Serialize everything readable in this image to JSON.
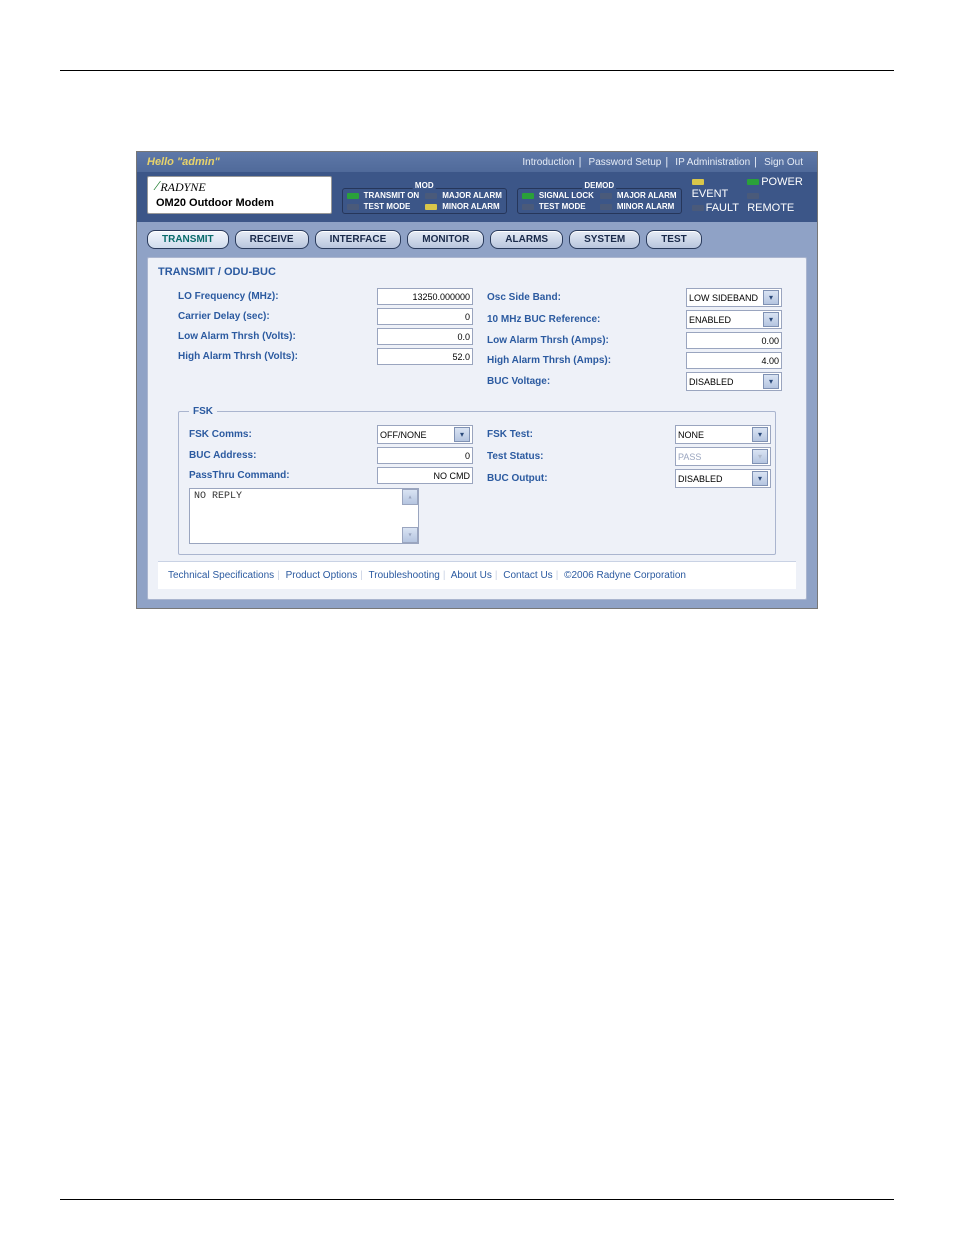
{
  "topbar": {
    "hello": "Hello \"admin\"",
    "links": [
      "Introduction",
      "Password Setup",
      "IP Administration",
      "Sign Out"
    ]
  },
  "logo": {
    "brand": "RADYNE",
    "subtitle": "OM20 Outdoor Modem"
  },
  "status": {
    "mod": {
      "title": "MOD",
      "items": [
        {
          "label": "TRANSMIT ON",
          "led": "green"
        },
        {
          "label": "TEST MODE",
          "led": "dark"
        },
        {
          "label": "MAJOR ALARM",
          "led": "dark"
        },
        {
          "label": "MINOR ALARM",
          "led": "yellow"
        }
      ]
    },
    "demod": {
      "title": "DEMOD",
      "items": [
        {
          "label": "SIGNAL LOCK",
          "led": "green"
        },
        {
          "label": "TEST MODE",
          "led": "dark"
        },
        {
          "label": "MAJOR ALARM",
          "led": "dark"
        },
        {
          "label": "MINOR ALARM",
          "led": "dark"
        }
      ]
    },
    "sys": {
      "items": [
        {
          "label": "EVENT",
          "led": "yellow"
        },
        {
          "label": "FAULT",
          "led": "dark"
        },
        {
          "label": "POWER",
          "led": "green"
        },
        {
          "label": "REMOTE",
          "led": "dark"
        }
      ]
    }
  },
  "tabs": [
    "TRANSMIT",
    "RECEIVE",
    "INTERFACE",
    "MONITOR",
    "ALARMS",
    "SYSTEM",
    "TEST"
  ],
  "active_tab": 0,
  "section_title": "TRANSMIT / ODU-BUC",
  "left": [
    {
      "label": "LO Frequency (MHz):",
      "value": "13250.000000",
      "type": "input"
    },
    {
      "label": "Carrier Delay (sec):",
      "value": "0",
      "type": "input"
    },
    {
      "label": "Low Alarm Thrsh (Volts):",
      "value": "0.0",
      "type": "input"
    },
    {
      "label": "High Alarm Thrsh (Volts):",
      "value": "52.0",
      "type": "input"
    }
  ],
  "right": [
    {
      "label": "Osc Side Band:",
      "value": "LOW SIDEBAND",
      "type": "select"
    },
    {
      "label": "10 MHz BUC Reference:",
      "value": "ENABLED",
      "type": "select"
    },
    {
      "label": "Low Alarm Thrsh (Amps):",
      "value": "0.00",
      "type": "input"
    },
    {
      "label": "High Alarm Thrsh (Amps):",
      "value": "4.00",
      "type": "input"
    },
    {
      "label": "BUC Voltage:",
      "value": "DISABLED",
      "type": "select"
    }
  ],
  "fsk": {
    "legend": "FSK",
    "left": [
      {
        "label": "FSK Comms:",
        "value": "OFF/NONE",
        "type": "select"
      },
      {
        "label": "BUC Address:",
        "value": "0",
        "type": "input"
      },
      {
        "label": "PassThru Command:",
        "value": "NO CMD",
        "type": "input"
      }
    ],
    "right": [
      {
        "label": "FSK Test:",
        "value": "NONE",
        "type": "select"
      },
      {
        "label": "Test Status:",
        "value": "PASS",
        "type": "select",
        "disabled": true
      },
      {
        "label": "BUC Output:",
        "value": "DISABLED",
        "type": "select"
      }
    ],
    "reply": "NO REPLY"
  },
  "footer": {
    "links": [
      "Technical Specifications",
      "Product Options",
      "Troubleshooting",
      "About Us",
      "Contact Us"
    ],
    "copyright": "©2006 Radyne Corporation"
  }
}
